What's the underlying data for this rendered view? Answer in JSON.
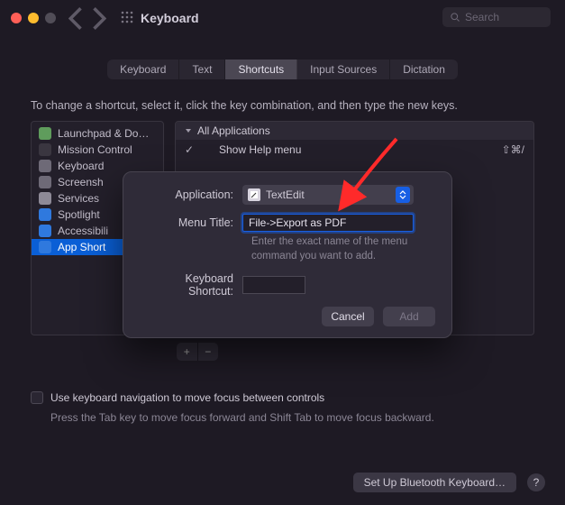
{
  "title": "Keyboard",
  "search_placeholder": "Search",
  "tabs": [
    "Keyboard",
    "Text",
    "Shortcuts",
    "Input Sources",
    "Dictation"
  ],
  "active_tab": 2,
  "instructions": "To change a shortcut, select it, click the key combination, and then type the new keys.",
  "sidebar": {
    "items": [
      {
        "label": "Launchpad & Do…",
        "color": "#5f9c5c"
      },
      {
        "label": "Mission Control",
        "color": "#3a3640"
      },
      {
        "label": "Keyboard",
        "color": "#6e6a77"
      },
      {
        "label": "Screensh",
        "color": "#6e6a77"
      },
      {
        "label": "Services",
        "color": "#8e8a97"
      },
      {
        "label": "Spotlight",
        "color": "#2f79de"
      },
      {
        "label": "Accessibili",
        "color": "#2f79de"
      },
      {
        "label": "App Short",
        "color": "#2f79de"
      }
    ],
    "selected": 7
  },
  "right": {
    "header": "All Applications",
    "rows": [
      {
        "checked": true,
        "name": "Show Help menu",
        "shortcut": "⇧⌘/"
      }
    ]
  },
  "kbnav_label": "Use keyboard navigation to move focus between controls",
  "kbnav_hint": "Press the Tab key to move focus forward and Shift Tab to move focus backward.",
  "footer_button": "Set Up Bluetooth Keyboard…",
  "sheet": {
    "application_label": "Application:",
    "application_value": "TextEdit",
    "menu_title_label": "Menu Title:",
    "menu_title_value": "File->Export as PDF",
    "menu_title_help": "Enter the exact name of the menu command you want to add.",
    "shortcut_label": "Keyboard Shortcut:",
    "cancel": "Cancel",
    "add": "Add"
  }
}
